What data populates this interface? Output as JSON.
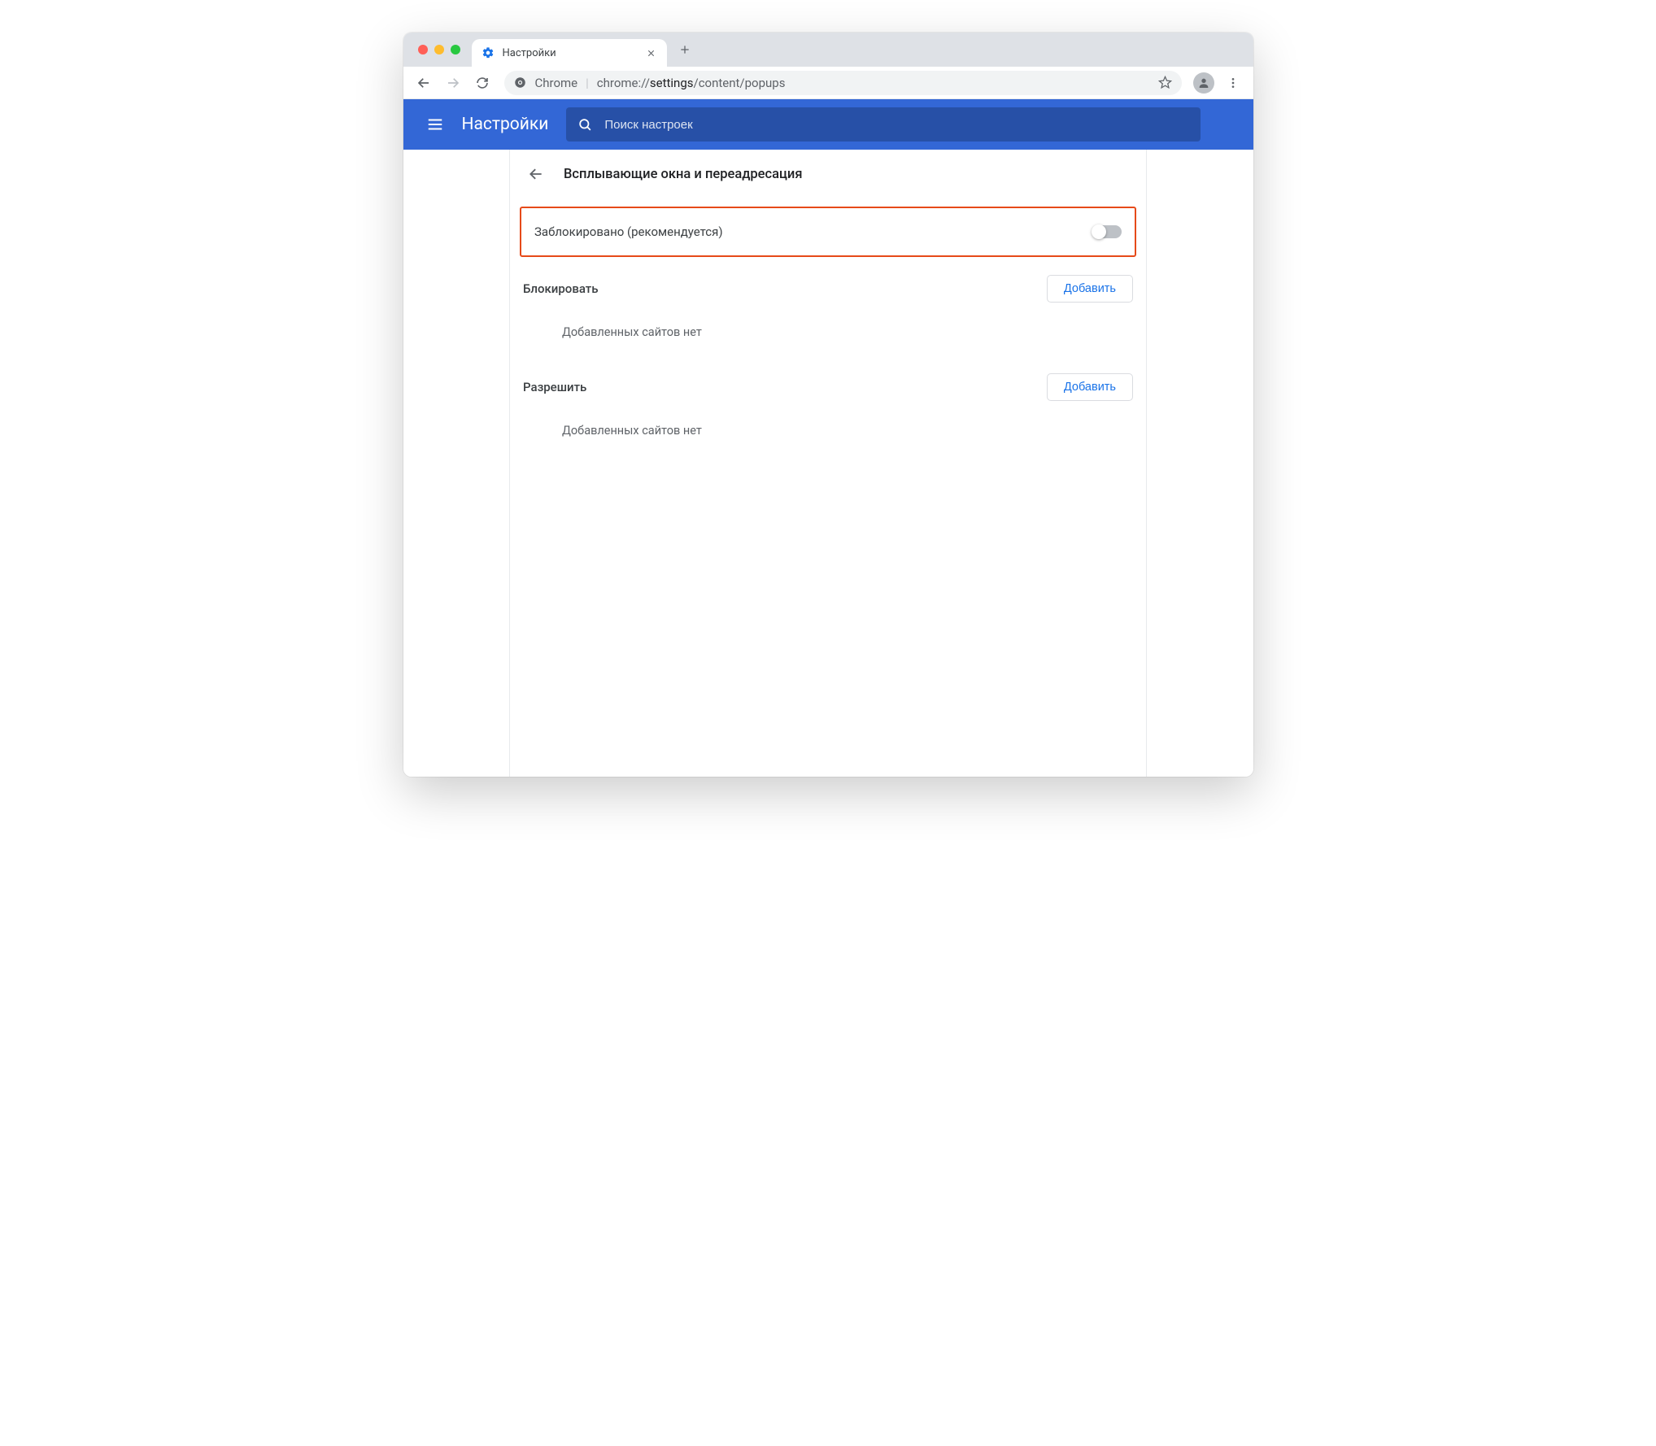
{
  "window": {
    "tab_title": "Настройки"
  },
  "omnibox": {
    "origin_label": "Chrome",
    "url_prefix": "chrome://",
    "url_bold": "settings",
    "url_suffix": "/content/popups"
  },
  "header": {
    "title": "Настройки",
    "search_placeholder": "Поиск настроек"
  },
  "page": {
    "heading": "Всплывающие окна и переадресация",
    "toggle_label": "Заблокировано (рекомендуется)",
    "block_section": {
      "title": "Блокировать",
      "add_label": "Добавить",
      "empty": "Добавленных сайтов нет"
    },
    "allow_section": {
      "title": "Разрешить",
      "add_label": "Добавить",
      "empty": "Добавленных сайтов нет"
    }
  }
}
